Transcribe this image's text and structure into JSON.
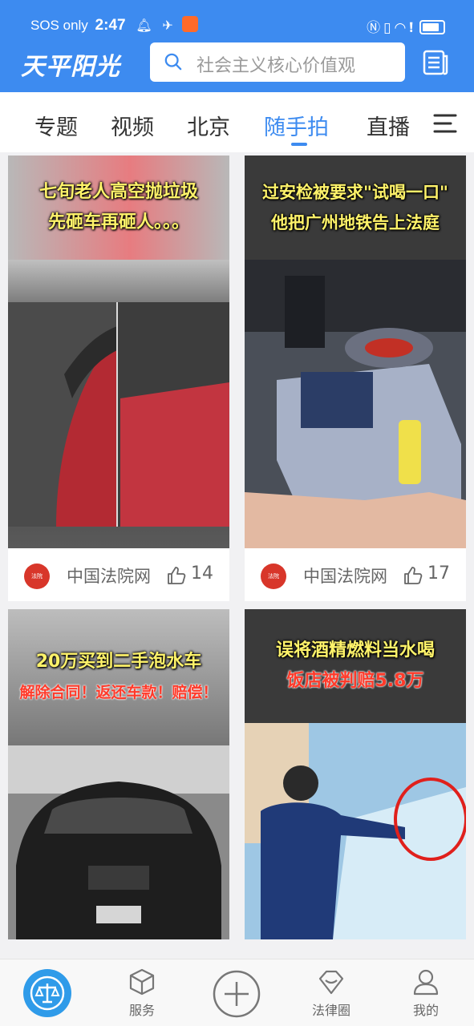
{
  "status_bar": {
    "carrier": "SOS only",
    "time": "2:47"
  },
  "header": {
    "logo_text": "天平阳光",
    "search_placeholder": "社会主义核心价值观"
  },
  "tabs": [
    {
      "label": "专题",
      "active": false
    },
    {
      "label": "视频",
      "active": false
    },
    {
      "label": "北京",
      "active": false
    },
    {
      "label": "随手拍",
      "active": true
    },
    {
      "label": "直播",
      "active": false
    }
  ],
  "cards": [
    {
      "headline_lines": [
        "七旬老人高空抛垃圾",
        "先砸车再砸人。。。"
      ],
      "source": "中国法院网",
      "likes": "14"
    },
    {
      "headline_lines": [
        "过安检被要求\"试喝一口\"",
        "他把广州地铁告上法庭"
      ],
      "source": "中国法院网",
      "likes": "17"
    },
    {
      "headline_lines": [
        "20万买到二手泡水车",
        "解除合同！返还车款！赔偿！"
      ],
      "source": "",
      "likes": ""
    },
    {
      "headline_lines": [
        "误将酒精燃料当水喝",
        "饭店被判赔5.8万"
      ],
      "source": "",
      "likes": ""
    }
  ],
  "bottom_nav": [
    {
      "label": "",
      "icon": "scales-icon"
    },
    {
      "label": "服务",
      "icon": "cube-icon"
    },
    {
      "label": "",
      "icon": "add-icon"
    },
    {
      "label": "法律圈",
      "icon": "diamond-icon"
    },
    {
      "label": "我的",
      "icon": "person-icon"
    }
  ],
  "colors": {
    "brand_blue": "#3d8bf0",
    "active_tab": "#3d8bf0",
    "headline_yellow": "#fff36a",
    "headline_red": "#ff3a2a"
  }
}
